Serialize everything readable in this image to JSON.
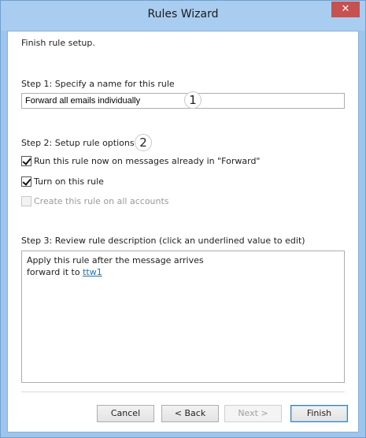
{
  "window": {
    "title": "Rules Wizard",
    "close_glyph": "✕"
  },
  "intro": "Finish rule setup.",
  "step1": {
    "label": "Step 1: Specify a name for this rule",
    "name_value": "Forward all emails individually",
    "badge": "1"
  },
  "step2": {
    "label": "Step 2: Setup rule options",
    "badge": "2",
    "options": [
      {
        "label": "Run this rule now on messages already in \"Forward\"",
        "checked": true,
        "enabled": true
      },
      {
        "label": "Turn on this rule",
        "checked": true,
        "enabled": true
      },
      {
        "label": "Create this rule on all accounts",
        "checked": false,
        "enabled": false
      }
    ]
  },
  "step3": {
    "label": "Step 3: Review rule description (click an underlined value to edit)",
    "line1": "Apply this rule after the message arrives",
    "line2_prefix": "forward it to ",
    "line2_link": "ttw1"
  },
  "buttons": {
    "cancel": "Cancel",
    "back": "< Back",
    "next": "Next >",
    "finish": "Finish"
  }
}
